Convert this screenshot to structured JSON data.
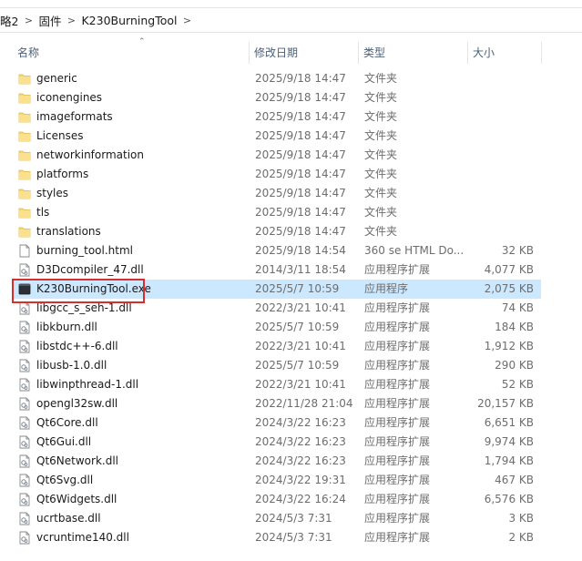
{
  "breadcrumb": {
    "items": [
      "略2",
      "固件",
      "K230BurningTool"
    ]
  },
  "columns": {
    "name": "名称",
    "date": "修改日期",
    "type": "类型",
    "size": "大小"
  },
  "files": [
    {
      "name": "generic",
      "date": "2025/9/18 14:47",
      "type": "文件夹",
      "size": "",
      "icon": "folder-icon"
    },
    {
      "name": "iconengines",
      "date": "2025/9/18 14:47",
      "type": "文件夹",
      "size": "",
      "icon": "folder-icon"
    },
    {
      "name": "imageformats",
      "date": "2025/9/18 14:47",
      "type": "文件夹",
      "size": "",
      "icon": "folder-icon"
    },
    {
      "name": "Licenses",
      "date": "2025/9/18 14:47",
      "type": "文件夹",
      "size": "",
      "icon": "folder-icon"
    },
    {
      "name": "networkinformation",
      "date": "2025/9/18 14:47",
      "type": "文件夹",
      "size": "",
      "icon": "folder-icon"
    },
    {
      "name": "platforms",
      "date": "2025/9/18 14:47",
      "type": "文件夹",
      "size": "",
      "icon": "folder-icon"
    },
    {
      "name": "styles",
      "date": "2025/9/18 14:47",
      "type": "文件夹",
      "size": "",
      "icon": "folder-icon"
    },
    {
      "name": "tls",
      "date": "2025/9/18 14:47",
      "type": "文件夹",
      "size": "",
      "icon": "folder-icon"
    },
    {
      "name": "translations",
      "date": "2025/9/18 14:47",
      "type": "文件夹",
      "size": "",
      "icon": "folder-icon"
    },
    {
      "name": "burning_tool.html",
      "date": "2025/9/18 14:54",
      "type": "360 se HTML Do...",
      "size": "32 KB",
      "icon": "html-file-icon"
    },
    {
      "name": "D3Dcompiler_47.dll",
      "date": "2014/3/11 18:54",
      "type": "应用程序扩展",
      "size": "4,077 KB",
      "icon": "dll-file-icon"
    },
    {
      "name": "K230BurningTool.exe",
      "date": "2025/5/7 10:59",
      "type": "应用程序",
      "size": "2,075 KB",
      "icon": "exe-file-icon",
      "selected": true
    },
    {
      "name": "libgcc_s_seh-1.dll",
      "date": "2022/3/21 10:41",
      "type": "应用程序扩展",
      "size": "74 KB",
      "icon": "dll-file-icon"
    },
    {
      "name": "libkburn.dll",
      "date": "2025/5/7 10:59",
      "type": "应用程序扩展",
      "size": "184 KB",
      "icon": "dll-file-icon"
    },
    {
      "name": "libstdc++-6.dll",
      "date": "2022/3/21 10:41",
      "type": "应用程序扩展",
      "size": "1,912 KB",
      "icon": "dll-file-icon"
    },
    {
      "name": "libusb-1.0.dll",
      "date": "2025/5/7 10:59",
      "type": "应用程序扩展",
      "size": "290 KB",
      "icon": "dll-file-icon"
    },
    {
      "name": "libwinpthread-1.dll",
      "date": "2022/3/21 10:41",
      "type": "应用程序扩展",
      "size": "52 KB",
      "icon": "dll-file-icon"
    },
    {
      "name": "opengl32sw.dll",
      "date": "2022/11/28 21:04",
      "type": "应用程序扩展",
      "size": "20,157 KB",
      "icon": "dll-file-icon"
    },
    {
      "name": "Qt6Core.dll",
      "date": "2024/3/22 16:23",
      "type": "应用程序扩展",
      "size": "6,651 KB",
      "icon": "dll-file-icon"
    },
    {
      "name": "Qt6Gui.dll",
      "date": "2024/3/22 16:23",
      "type": "应用程序扩展",
      "size": "9,974 KB",
      "icon": "dll-file-icon"
    },
    {
      "name": "Qt6Network.dll",
      "date": "2024/3/22 16:23",
      "type": "应用程序扩展",
      "size": "1,794 KB",
      "icon": "dll-file-icon"
    },
    {
      "name": "Qt6Svg.dll",
      "date": "2024/3/22 19:31",
      "type": "应用程序扩展",
      "size": "467 KB",
      "icon": "dll-file-icon"
    },
    {
      "name": "Qt6Widgets.dll",
      "date": "2024/3/22 16:24",
      "type": "应用程序扩展",
      "size": "6,576 KB",
      "icon": "dll-file-icon"
    },
    {
      "name": "ucrtbase.dll",
      "date": "2024/5/3 7:31",
      "type": "应用程序扩展",
      "size": "3 KB",
      "icon": "dll-file-icon"
    },
    {
      "name": "vcruntime140.dll",
      "date": "2024/5/3 7:31",
      "type": "应用程序扩展",
      "size": "2 KB",
      "icon": "dll-file-icon"
    }
  ],
  "colors": {
    "selection": "#cce8ff",
    "highlight_border": "#d62f2f",
    "folder": "#f8d775",
    "header_text": "#4c607a"
  }
}
